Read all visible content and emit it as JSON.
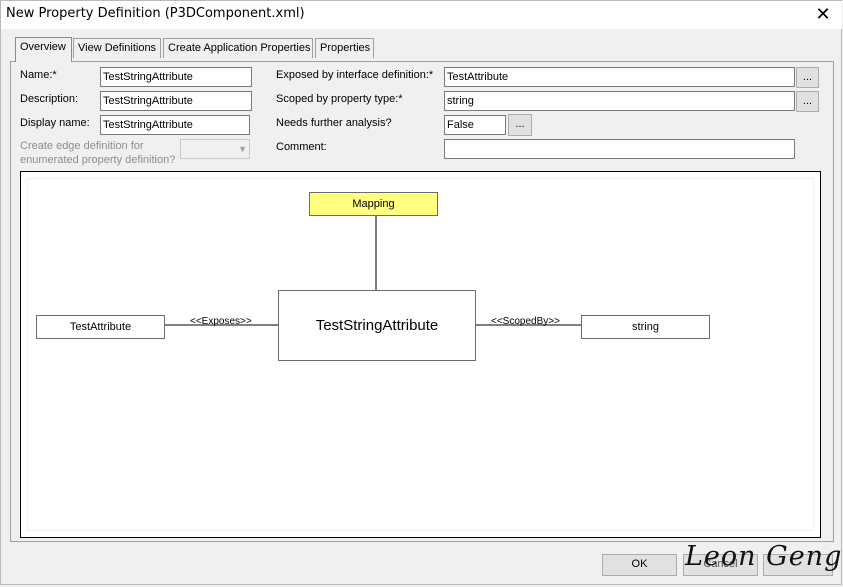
{
  "window": {
    "title": "New Property Definition (P3DComponent.xml)"
  },
  "tabs": [
    "Overview",
    "View Definitions",
    "Create Application Properties",
    "Properties"
  ],
  "form": {
    "name_label": "Name:*",
    "name_value": "TestStringAttribute",
    "description_label": "Description:",
    "description_value": "TestStringAttribute",
    "display_name_label": "Display name:",
    "display_name_value": "TestStringAttribute",
    "edge_label_1": "Create edge definition for",
    "edge_label_2": "enumerated property definition?",
    "exposed_label": "Exposed by interface definition:*",
    "exposed_value": "TestAttribute",
    "scoped_label": "Scoped by property type:*",
    "scoped_value": "string",
    "needs_label": "Needs further analysis?",
    "needs_value": "False",
    "comment_label": "Comment:",
    "comment_value": "",
    "browse": "..."
  },
  "diagram": {
    "center": "TestStringAttribute",
    "top": "Mapping",
    "left": "TestAttribute",
    "right": "string",
    "left_connector": "<<Exposes>>",
    "right_connector": "<<ScopedBy>>",
    "top_color": "#ffff80"
  },
  "footer": {
    "ok": "OK",
    "cancel": "Cancel",
    "signature": "Leon Geng"
  }
}
